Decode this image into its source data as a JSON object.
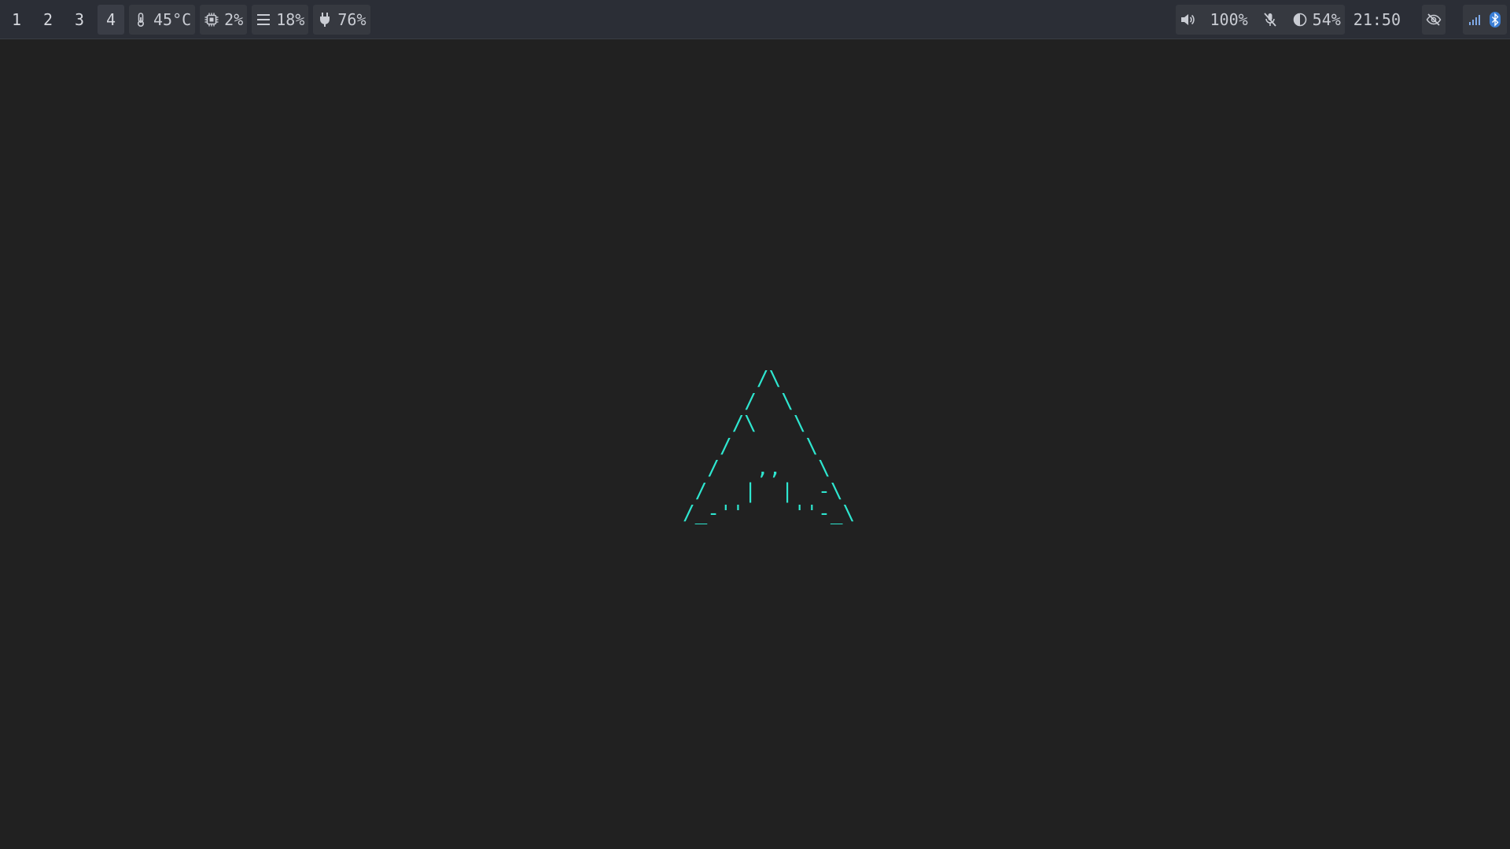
{
  "workspaces": [
    {
      "label": "1",
      "active": false
    },
    {
      "label": "2",
      "active": false
    },
    {
      "label": "3",
      "active": false
    },
    {
      "label": "4",
      "active": true
    }
  ],
  "status_left": {
    "temperature": "45°C",
    "cpu": "2%",
    "memory": "18%",
    "battery": "76%"
  },
  "status_right": {
    "volume": "100%",
    "brightness": "54%",
    "clock": "21:50"
  },
  "icons": {
    "temperature": "thermometer-icon",
    "cpu": "cpu-chip-icon",
    "memory": "memory-lines-icon",
    "battery": "power-plug-icon",
    "volume": "speaker-icon",
    "mic": "microphone-muted-icon",
    "brightness": "brightness-half-icon",
    "privacy": "eye-slash-icon",
    "network": "signal-bars-icon",
    "bluetooth": "bluetooth-icon"
  },
  "colors": {
    "bar": "#2b2e36",
    "background": "#212121",
    "text": "#c9ccd3",
    "logo": "#2ee6cf",
    "bluetooth_bg": "#3b7fd6"
  },
  "desktop": {
    "logo_ascii": "      /\\\n     /  \\\n    /\\   \\\n   /      \\\n  /   ,,   \\\n /   |  |  -\\\n/_-''    ''-_\\"
  }
}
